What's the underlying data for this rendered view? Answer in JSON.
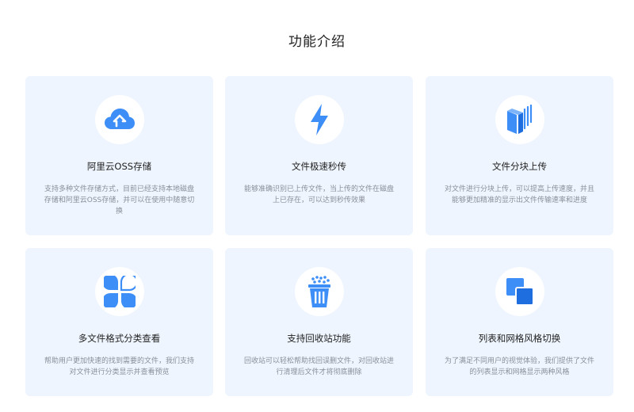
{
  "section": {
    "title": "功能介绍"
  },
  "features": [
    {
      "icon": "cloud-upload-icon",
      "title": "阿里云OSS存储",
      "desc": "支持多种文件存储方式，目前已经支持本地磁盘存储和阿里云OSS存储，并可以在使用中随意切换"
    },
    {
      "icon": "lightning-icon",
      "title": "文件极速秒传",
      "desc": "能够准确识别已上传文件，当上传的文件在磁盘上已存在，可以达到秒传效果"
    },
    {
      "icon": "file-chunks-icon",
      "title": "文件分块上传",
      "desc": "对文件进行分块上传，可以提高上传速度，并且能够更加精准的显示出文件传输速率和进度"
    },
    {
      "icon": "category-grid-icon",
      "title": "多文件格式分类查看",
      "desc": "帮助用户更加快速的找到需要的文件，我们支持对文件进行分类显示并查看预览"
    },
    {
      "icon": "recycle-bin-icon",
      "title": "支持回收站功能",
      "desc": "回收站可以轻松帮助找回误删文件，对回收站进行清理后文件才将彻底删除"
    },
    {
      "icon": "layout-switch-icon",
      "title": "列表和网格风格切换",
      "desc": "为了满足不同用户的视觉体验，我们提供了文件的列表显示和网格显示两种风格"
    }
  ],
  "colors": {
    "accent": "#3e8ef7",
    "card_bg": "#eef5fe",
    "title": "#222222",
    "desc": "#8a8f99"
  }
}
